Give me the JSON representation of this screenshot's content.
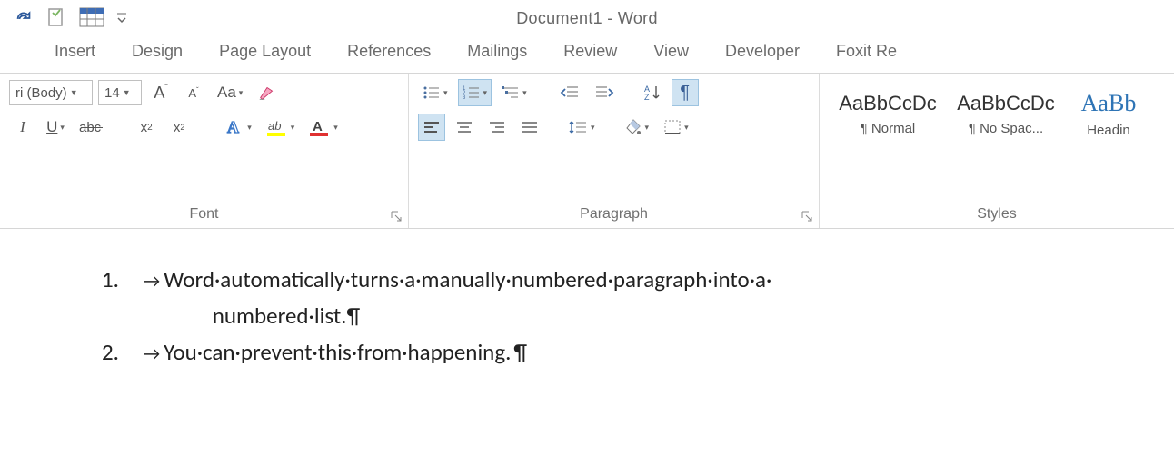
{
  "title": "Document1 - Word",
  "tabs": [
    "Insert",
    "Design",
    "Page Layout",
    "References",
    "Mailings",
    "Review",
    "View",
    "Developer",
    "Foxit Re"
  ],
  "font": {
    "name_display": "ri (Body)",
    "size": "14",
    "group_label": "Font"
  },
  "paragraph": {
    "group_label": "Paragraph"
  },
  "styles": {
    "group_label": "Styles",
    "items": [
      {
        "sample": "AaBbCcDc",
        "name": "¶ Normal"
      },
      {
        "sample": "AaBbCcDc",
        "name": "¶ No Spac..."
      },
      {
        "sample": "AaBb",
        "name": "Headin",
        "blue": true
      }
    ]
  },
  "document": {
    "line1a": "Word·automatically·turns·a·manually·numbered·paragraph·into·a·",
    "line1b": "numbered·list.¶",
    "line2": "You·can·prevent·this·from·happening.",
    "num1": "1.",
    "num2": "2."
  }
}
